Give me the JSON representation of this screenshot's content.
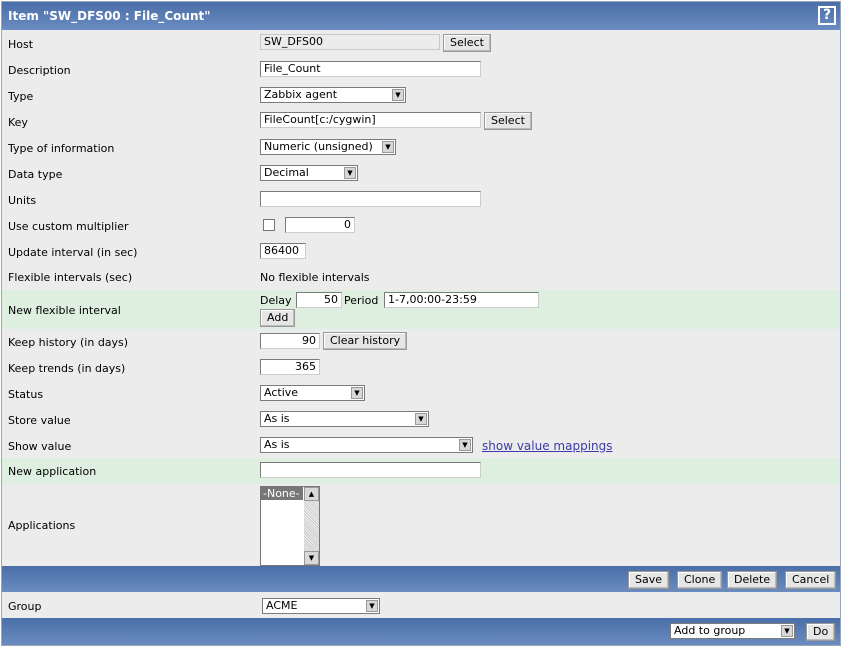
{
  "title": "Item \"SW_DFS00 : File_Count\"",
  "help_icon": "?",
  "fields": {
    "host": {
      "label": "Host",
      "value": "SW_DFS00",
      "button": "Select"
    },
    "description": {
      "label": "Description",
      "value": "File_Count"
    },
    "type": {
      "label": "Type",
      "value": "Zabbix agent"
    },
    "key": {
      "label": "Key",
      "value": "FileCount[c:/cygwin]",
      "button": "Select"
    },
    "type_of_information": {
      "label": "Type of information",
      "value": "Numeric (unsigned)"
    },
    "data_type": {
      "label": "Data type",
      "value": "Decimal"
    },
    "units": {
      "label": "Units",
      "value": ""
    },
    "custom_multiplier": {
      "label": "Use custom multiplier",
      "checked": false,
      "value": "0"
    },
    "update_interval": {
      "label": "Update interval (in sec)",
      "value": "86400"
    },
    "flexible_intervals": {
      "label": "Flexible intervals (sec)",
      "value": "No flexible intervals"
    },
    "new_flexible_interval": {
      "label": "New flexible interval",
      "delay_label": "Delay",
      "delay": "50",
      "period_label": "Period",
      "period": "1-7,00:00-23:59",
      "button": "Add"
    },
    "keep_history": {
      "label": "Keep history (in days)",
      "value": "90",
      "button": "Clear history"
    },
    "keep_trends": {
      "label": "Keep trends (in days)",
      "value": "365"
    },
    "status": {
      "label": "Status",
      "value": "Active"
    },
    "store_value": {
      "label": "Store value",
      "value": "As is"
    },
    "show_value": {
      "label": "Show value",
      "value": "As is",
      "link": "show value mappings"
    },
    "new_application": {
      "label": "New application",
      "value": ""
    },
    "applications": {
      "label": "Applications",
      "options": [
        "-None-"
      ]
    }
  },
  "actions": {
    "save": "Save",
    "clone": "Clone",
    "delete": "Delete",
    "cancel": "Cancel"
  },
  "group": {
    "label": "Group",
    "value": "ACME"
  },
  "bottom": {
    "action": "Add to group",
    "do": "Do"
  }
}
